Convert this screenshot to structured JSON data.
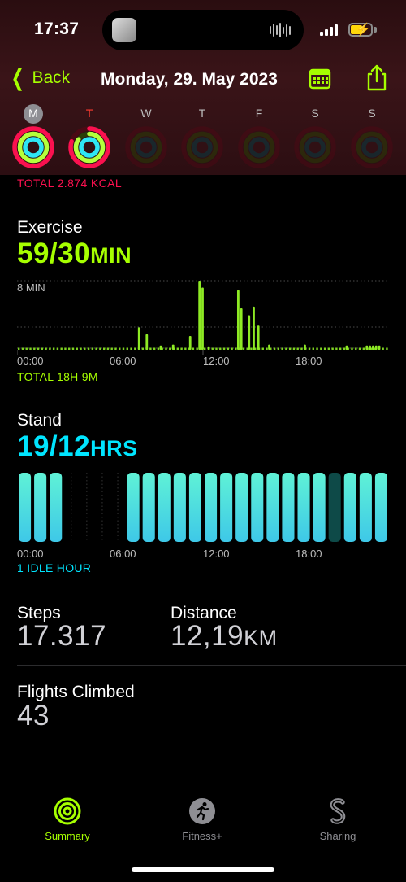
{
  "status_bar": {
    "time": "17:37"
  },
  "nav": {
    "back_label": "Back",
    "title": "Monday, 29. May 2023",
    "calendar_icon": "calendar-icon",
    "share_icon": "share-icon"
  },
  "week": {
    "days": [
      {
        "letter": "M",
        "state": "selected",
        "move": 1.0,
        "exercise": 1.0,
        "stand": 1.0
      },
      {
        "letter": "T",
        "state": "today",
        "move": 0.8,
        "exercise": 0.85,
        "stand": 1.0
      },
      {
        "letter": "W",
        "state": "future",
        "move": 0,
        "exercise": 0,
        "stand": 0
      },
      {
        "letter": "T",
        "state": "future",
        "move": 0,
        "exercise": 0,
        "stand": 0
      },
      {
        "letter": "F",
        "state": "future",
        "move": 0,
        "exercise": 0,
        "stand": 0
      },
      {
        "letter": "S",
        "state": "future",
        "move": 0,
        "exercise": 0,
        "stand": 0
      },
      {
        "letter": "S",
        "state": "future",
        "move": 0,
        "exercise": 0,
        "stand": 0
      }
    ]
  },
  "move": {
    "total": "TOTAL 2.874 KCAL"
  },
  "exercise": {
    "title": "Exercise",
    "value": "59/30",
    "unit": "MIN",
    "max_label": "8 MIN",
    "x_labels": [
      "00:00",
      "06:00",
      "12:00",
      "18:00"
    ],
    "total": "TOTAL 18H 9M"
  },
  "stand": {
    "title": "Stand",
    "value": "19/12",
    "unit": "HRS",
    "x_labels": [
      "00:00",
      "06:00",
      "12:00",
      "18:00"
    ],
    "idle": "1 IDLE HOUR"
  },
  "steps": {
    "title": "Steps",
    "value": "17.317"
  },
  "distance": {
    "title": "Distance",
    "value": "12,19",
    "unit": "KM"
  },
  "flights": {
    "title": "Flights Climbed",
    "value": "43"
  },
  "tabs": [
    {
      "label": "Summary",
      "icon": "activity-rings-icon",
      "active": true
    },
    {
      "label": "Fitness+",
      "icon": "running-figure-icon",
      "active": false
    },
    {
      "label": "Sharing",
      "icon": "sharing-s-icon",
      "active": false
    }
  ],
  "colors": {
    "accent_green": "#a6ff00",
    "move_red": "#fa114f",
    "stand_cyan": "#00e5ff",
    "exercise_ring": "#b4ff3c",
    "stand_ring": "#2ee6f5"
  },
  "chart_data": [
    {
      "type": "bar",
      "title": "Exercise",
      "ylabel": "MIN",
      "ylim": [
        0,
        8
      ],
      "x_labels": [
        "00:00",
        "06:00",
        "12:00",
        "18:00"
      ],
      "values": [
        0.3,
        0.3,
        0.3,
        0.3,
        0.3,
        0.3,
        0.3,
        0.3,
        0.3,
        0.3,
        0.3,
        0.3,
        0.3,
        0.3,
        0.3,
        0.3,
        0.3,
        0.3,
        0.3,
        0.3,
        0.3,
        0.3,
        0.3,
        0.3,
        0.3,
        0.3,
        0.3,
        0.3,
        0.3,
        0.3,
        0.3,
        0.3,
        0.3,
        0.3,
        0.3,
        0.3,
        0.3,
        0.3,
        0.3,
        0.3,
        0.3,
        0.3,
        0.3,
        0.3,
        0.3,
        0.3,
        0.3,
        0.3,
        0.3,
        0.3,
        0.3,
        0.3,
        0.3,
        0.3,
        0.3,
        0.3,
        0.3,
        0.3,
        0.3,
        0.3,
        0.3,
        0.3,
        0.3,
        0.3,
        0.3,
        0.3,
        0.3,
        0.3,
        0.3,
        0.3,
        0.3,
        0.3,
        0.3,
        0.3,
        0.3,
        0.3,
        0.3,
        0.3,
        0.3,
        0.3,
        0.3,
        0.3,
        0.3,
        0.3,
        0.3,
        0.3,
        0.3,
        0.3,
        0.3,
        0.3,
        0.3,
        0.3,
        0.3,
        0.3,
        0.3,
        0.3,
        0.3,
        0.3,
        0.3,
        0.3,
        0.3,
        0.3,
        0.3,
        0.3,
        0.3,
        0.3,
        0.3,
        0.3,
        0.3,
        0.3,
        0.3,
        0.3,
        0.3,
        0.3,
        0.3,
        0.3,
        0.3,
        0.3,
        0.3,
        0.3,
        0.3,
        0.3,
        0.3,
        0.3,
        0.3,
        0.3,
        0.3,
        0.3,
        0.3,
        0.3,
        0.3,
        0.3,
        0.3,
        0.3,
        0.3,
        0.3,
        0.3,
        0.3,
        0.3,
        0.3,
        0.3,
        0.3,
        0.3,
        0.3,
        0.3,
        0.3,
        0.3,
        0.3,
        0.3,
        0.3,
        0.3,
        0.3,
        0.3,
        0.3,
        0.3,
        0.3,
        0.3,
        0.3,
        0.3,
        0.3,
        0.3,
        0.3,
        0.3,
        0.3,
        0.3,
        0.3,
        0.3,
        0.3,
        0.3,
        0.3,
        0.3,
        0.3,
        0.3,
        0.3,
        0.3,
        0.3,
        0.3,
        0.3,
        0.3,
        0.3,
        0.3,
        0.3,
        0.3,
        0.3,
        0.3,
        0.3,
        0.3,
        0.3,
        0.3,
        0.3,
        0.3,
        0.3,
        0.3,
        0.3,
        0.3,
        0.3,
        0.3,
        0.3,
        0.3,
        0.3,
        0.3,
        0.3,
        0.3,
        0.3,
        0.3,
        0.3,
        0.3,
        0.3,
        0.3,
        0.3,
        0.3,
        0.3,
        0.3,
        0.3,
        0.3,
        0.3,
        0.3,
        0.3,
        0.3,
        0.3,
        0.3,
        0.3,
        0.3,
        0.3,
        0.3,
        0.3,
        0.3,
        0.3,
        0.3,
        0.3,
        0.3,
        0.3,
        0.3,
        0.3,
        0.3,
        0.3,
        0.3,
        0.3,
        0.3,
        0.3,
        0.3,
        0.3,
        0.3
      ],
      "bars": [
        {
          "hour": 7.8,
          "value": 2.6
        },
        {
          "hour": 8.3,
          "value": 1.8
        },
        {
          "hour": 9.2,
          "value": 0.5
        },
        {
          "hour": 10.0,
          "value": 0.6
        },
        {
          "hour": 11.1,
          "value": 1.6
        },
        {
          "hour": 11.7,
          "value": 8.0
        },
        {
          "hour": 11.9,
          "value": 7.2
        },
        {
          "hour": 12.3,
          "value": 0.4
        },
        {
          "hour": 14.2,
          "value": 6.9
        },
        {
          "hour": 14.4,
          "value": 4.8
        },
        {
          "hour": 14.9,
          "value": 4.0
        },
        {
          "hour": 15.2,
          "value": 5.0
        },
        {
          "hour": 15.5,
          "value": 2.8
        },
        {
          "hour": 16.2,
          "value": 0.6
        },
        {
          "hour": 18.5,
          "value": 0.6
        },
        {
          "hour": 21.2,
          "value": 0.5
        },
        {
          "hour": 22.5,
          "value": 0.5
        },
        {
          "hour": 22.7,
          "value": 0.5
        },
        {
          "hour": 22.9,
          "value": 0.5
        },
        {
          "hour": 23.1,
          "value": 0.5
        },
        {
          "hour": 23.3,
          "value": 0.5
        }
      ],
      "baseline_min": 0.3,
      "ticks": [
        {
          "hour": 22.5,
          "value": 0.5
        }
      ]
    },
    {
      "type": "bar",
      "title": "Stand",
      "ylabel": "HRS",
      "x_labels": [
        "00:00",
        "06:00",
        "12:00",
        "18:00"
      ],
      "hours": [
        1,
        1,
        1,
        0,
        0,
        0,
        0,
        1,
        1,
        1,
        1,
        1,
        1,
        1,
        1,
        1,
        1,
        1,
        1,
        1,
        -1,
        1,
        1,
        1
      ]
    }
  ]
}
